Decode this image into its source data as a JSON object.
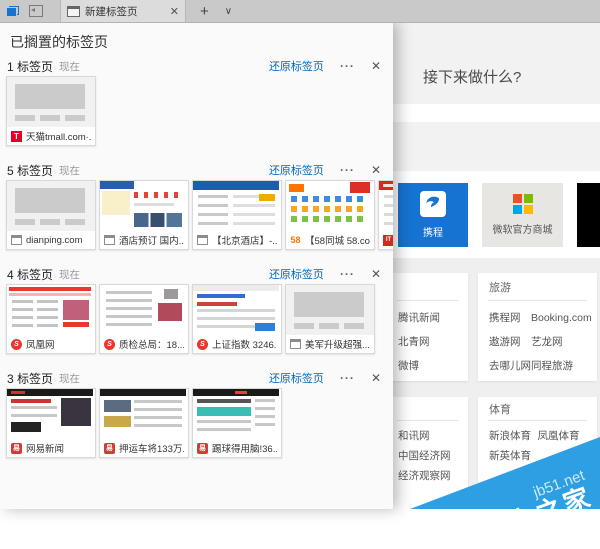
{
  "colors": {
    "accent_blue": "#0067b8",
    "ctrip_tile": "#1673d2",
    "watermark_blue": "#2d9fe2",
    "tabbar_gray": "#c9c9c9"
  },
  "icons": {
    "set_aside_tabs": "tabs-set-aside",
    "put_tabs_aside": "set-tabs-aside",
    "close_tab": "✕",
    "new_tab_button": "+",
    "tab_preview": "∨",
    "group_more": "···",
    "group_close": "✕"
  },
  "tabbar": {
    "tab_title": "新建标签页"
  },
  "panel": {
    "title": "已搁置的标签页",
    "restore_label": "还原标签页",
    "time_label": "现在",
    "groups": [
      {
        "count_label": "1 标签页",
        "tabs": [
          {
            "label": "天猫tmall.com·...",
            "favicon": "tmall",
            "thumb": "placeholder"
          }
        ]
      },
      {
        "count_label": "5 标签页",
        "tabs": [
          {
            "label": "dianping.com",
            "favicon": "page",
            "thumb": "placeholder"
          },
          {
            "label": "酒店预订 国内...",
            "favicon": "page",
            "thumb": "hotel"
          },
          {
            "label": "【北京酒店】-...",
            "favicon": "page",
            "thumb": "bjhotel"
          },
          {
            "label": "【58同城 58.co...",
            "favicon": "f58",
            "thumb": "site58"
          },
          {
            "label": "IT之...",
            "favicon": "ithome",
            "thumb": "ithome"
          }
        ]
      },
      {
        "count_label": "4 标签页",
        "tabs": [
          {
            "label": "凤凰网",
            "favicon": "ifeng",
            "thumb": "ifeng"
          },
          {
            "label": "质检总局：18...",
            "favicon": "ifeng",
            "thumb": "article1"
          },
          {
            "label": "上证指数 3246...",
            "favicon": "ifeng",
            "thumb": "stock"
          },
          {
            "label": "美军升级超强...",
            "favicon": "page",
            "thumb": "placeholder"
          }
        ]
      },
      {
        "count_label": "3 标签页",
        "tabs": [
          {
            "label": "网易新闻",
            "favicon": "netease",
            "thumb": "netease"
          },
          {
            "label": "押运车将133万...",
            "favicon": "netease",
            "thumb": "article2"
          },
          {
            "label": "踢球得用脑!36...",
            "favicon": "netease",
            "thumb": "article3"
          }
        ]
      }
    ]
  },
  "newtab": {
    "heading": "接下来做什么?",
    "tiles": [
      {
        "label": "携程",
        "type": "ctrip"
      },
      {
        "label": "微软官方商城",
        "type": "msstore"
      },
      {
        "label": "",
        "type": "black"
      }
    ],
    "cards_top": [
      {
        "header": "",
        "col1": [
          "腾讯新闻",
          "北青网",
          "微博"
        ],
        "col2": []
      },
      {
        "header": "旅游",
        "col1": [
          "携程网",
          "遨游网",
          "去哪儿网"
        ],
        "col2": [
          "Booking.com",
          "艺龙网",
          "同程旅游"
        ]
      }
    ],
    "cards_bottom": [
      {
        "header": "",
        "col1": [
          "和讯网",
          "中国经济网",
          "经济观察网"
        ],
        "col2": []
      },
      {
        "header": "体育",
        "col1": [
          "新浪体育",
          "新英体育"
        ],
        "col2": [
          "凤凰体育"
        ]
      }
    ]
  },
  "watermark": {
    "site": "jb51.net",
    "name": "脚本之家"
  }
}
